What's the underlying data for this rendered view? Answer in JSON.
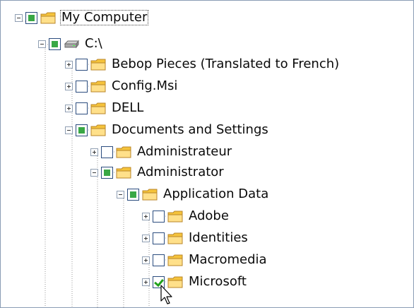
{
  "tree": {
    "root": {
      "label": "My Computer",
      "icon": "folder-icon",
      "state": "partial",
      "expanded": true
    },
    "drive": {
      "label": "C:\\",
      "icon": "drive-icon",
      "state": "partial",
      "expanded": true
    },
    "c_children": [
      {
        "label": "Bebop Pieces (Translated to French)",
        "icon": "folder-icon",
        "state": "unchecked",
        "expanded": false
      },
      {
        "label": "Config.Msi",
        "icon": "folder-icon",
        "state": "unchecked",
        "expanded": false
      },
      {
        "label": "DELL",
        "icon": "folder-icon",
        "state": "unchecked",
        "expanded": false
      },
      {
        "label": "Documents and Settings",
        "icon": "folder-icon",
        "state": "partial",
        "expanded": true
      }
    ],
    "doc_children": [
      {
        "label": "Administrateur",
        "icon": "folder-icon",
        "state": "unchecked",
        "expanded": false
      },
      {
        "label": "Administrator",
        "icon": "folder-icon",
        "state": "partial",
        "expanded": true
      }
    ],
    "admin_children": [
      {
        "label": "Application Data",
        "icon": "folder-icon",
        "state": "partial",
        "expanded": true
      }
    ],
    "appdata_children": [
      {
        "label": "Adobe",
        "icon": "folder-icon",
        "state": "unchecked",
        "expanded": false
      },
      {
        "label": "Identities",
        "icon": "folder-icon",
        "state": "unchecked",
        "expanded": false
      },
      {
        "label": "Macromedia",
        "icon": "folder-icon",
        "state": "unchecked",
        "expanded": false
      },
      {
        "label": "Microsoft",
        "icon": "folder-icon",
        "state": "checked",
        "expanded": false
      }
    ]
  },
  "colors": {
    "partial_fill": "#39a845",
    "check": "#21a11c",
    "folder": "#f5c33b",
    "border": "#2b4c7e"
  }
}
